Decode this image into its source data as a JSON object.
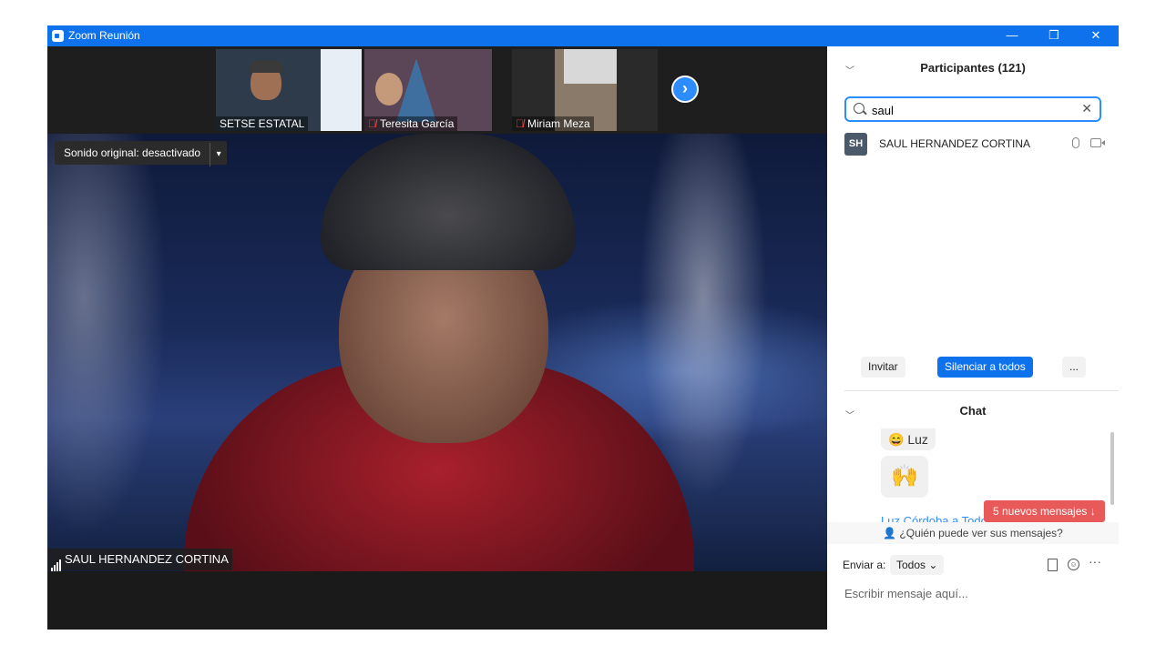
{
  "window": {
    "title": "Zoom Reunión",
    "controls": {
      "minimize": "—",
      "maximize": "❐",
      "close": "✕"
    }
  },
  "thumbnails": [
    {
      "name": "SETSE ESTATAL",
      "muted": false
    },
    {
      "name": "Teresita García",
      "muted": true
    },
    {
      "name": "Miriam Meza",
      "muted": true
    }
  ],
  "next_page_icon": "›",
  "main_video": {
    "sound_toggle_label": "Sonido original: desactivado",
    "caret": "▾",
    "speaker_name": "SAUL HERNANDEZ CORTINA"
  },
  "participants": {
    "header": "Participantes (121)",
    "search_value": "saul",
    "clear_icon": "✕",
    "list": [
      {
        "initials": "SH",
        "name": "SAUL HERNANDEZ CORTINA"
      }
    ],
    "buttons": {
      "invite": "Invitar",
      "mute_all": "Silenciar a todos",
      "more": "..."
    }
  },
  "chat": {
    "header": "Chat",
    "messages": [
      {
        "emoji": "😄",
        "text": "Luz"
      },
      {
        "emoji": "🙌"
      }
    ],
    "partial_sender": "Luz Córdoba a Todos",
    "new_messages": "5 nuevos mensajes",
    "new_messages_arrow": "↓",
    "who_sees": "¿Quién puede ver sus mensajes?",
    "send_to_label": "Enviar a:",
    "send_to_value": "Todos",
    "input_placeholder": "Escribir mensaje aquí..."
  },
  "colors": {
    "title_bar": "#0e72ed",
    "accent_blue": "#2d8cff",
    "new_messages": "#e8595a",
    "muted_red": "#e53935"
  }
}
